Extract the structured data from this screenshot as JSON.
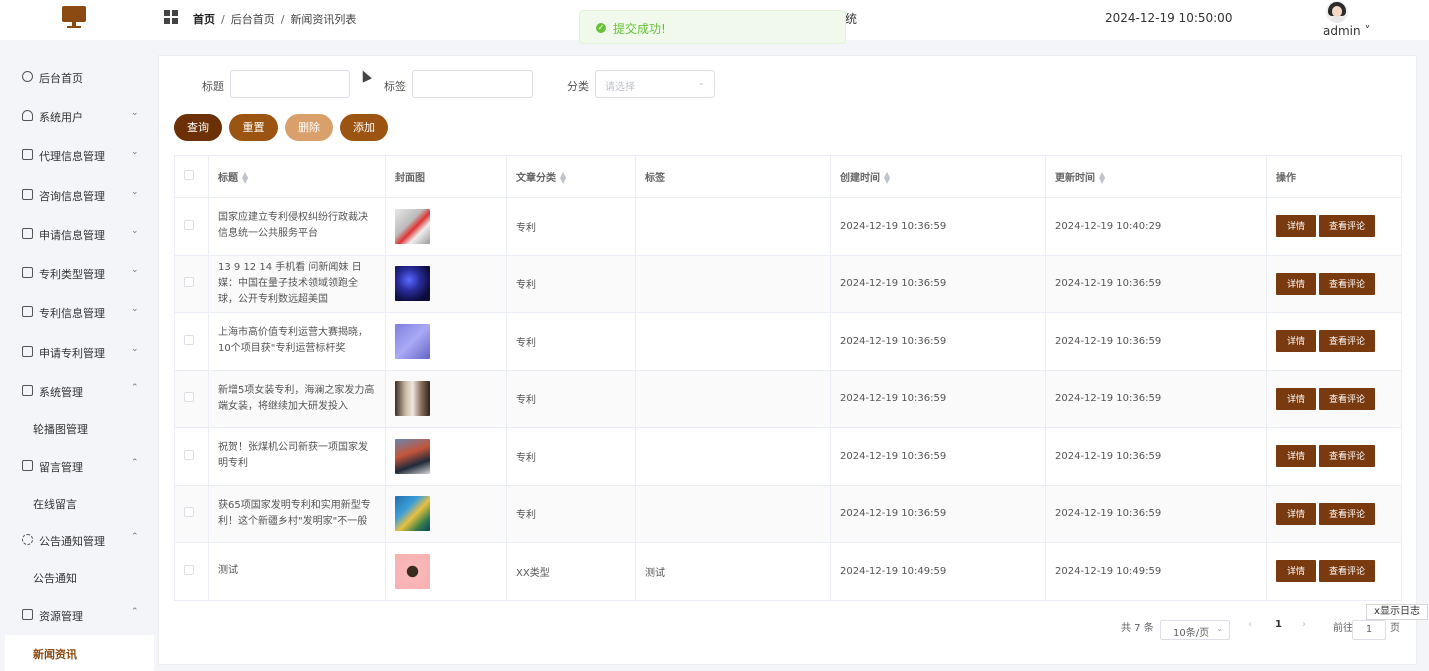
{
  "header": {
    "breadcrumb": [
      "首页",
      "后台首页",
      "新闻资讯列表"
    ],
    "sys_title": "统",
    "datetime": "2024-12-19 10:50:00",
    "user": "admin"
  },
  "toast": {
    "message": "提交成功!",
    "color": "#67c23a"
  },
  "sidebar": {
    "items": [
      {
        "label": "后台首页",
        "icon": "dashboard-icon",
        "arrow": ""
      },
      {
        "label": "系统用户",
        "icon": "user-icon",
        "arrow": "⌄"
      },
      {
        "label": "代理信息管理",
        "icon": "card-icon",
        "arrow": "⌄"
      },
      {
        "label": "咨询信息管理",
        "icon": "card-icon",
        "arrow": "⌄"
      },
      {
        "label": "申请信息管理",
        "icon": "card-icon",
        "arrow": "⌄"
      },
      {
        "label": "专利类型管理",
        "icon": "card-icon",
        "arrow": "⌄"
      },
      {
        "label": "专利信息管理",
        "icon": "card-icon",
        "arrow": "⌄"
      },
      {
        "label": "申请专利管理",
        "icon": "card-icon",
        "arrow": "⌄"
      },
      {
        "label": "系统管理",
        "icon": "check-icon",
        "arrow": "⌃"
      },
      {
        "label": "留言管理",
        "icon": "inbox-icon",
        "arrow": "⌃"
      },
      {
        "label": "公告通知管理",
        "icon": "sun-icon",
        "arrow": "⌃"
      },
      {
        "label": "资源管理",
        "icon": "folder-icon",
        "arrow": "⌃"
      }
    ],
    "subitems": [
      "轮播图管理",
      "在线留言",
      "公告通知",
      "新闻资讯"
    ]
  },
  "filters": {
    "title_label": "标题",
    "tag_label": "标签",
    "category_label": "分类",
    "category_placeholder": "请选择"
  },
  "buttons": {
    "query": "查询",
    "reset": "重置",
    "delete": "删除",
    "add": "添加"
  },
  "colors": {
    "accent": "#7a3a10",
    "query": "#6b3005",
    "reset": "#9c5412",
    "delete": "#d9a06b",
    "add": "#9c5412"
  },
  "table": {
    "columns": [
      "标题",
      "封面图",
      "文章分类",
      "标签",
      "创建时间",
      "更新时间",
      "操作"
    ],
    "rows": [
      {
        "title": "国家应建立专利侵权纠纷行政裁决信息统一公共服务平台",
        "category": "专利",
        "tag": "",
        "created": "2024-12-19 10:36:59",
        "updated": "2024-12-19 10:40:29"
      },
      {
        "title": "13 9 12 14 手机看 问新闻妹 日媒：中国在量子技术领域领跑全球，公开专利数远超美国",
        "category": "专利",
        "tag": "",
        "created": "2024-12-19 10:36:59",
        "updated": "2024-12-19 10:36:59"
      },
      {
        "title": "上海市高价值专利运营大赛揭晓，10个项目获\"专利运营标杆奖",
        "category": "专利",
        "tag": "",
        "created": "2024-12-19 10:36:59",
        "updated": "2024-12-19 10:36:59"
      },
      {
        "title": "新增5项女装专利，海澜之家发力高端女装，将继续加大研发投入",
        "category": "专利",
        "tag": "",
        "created": "2024-12-19 10:36:59",
        "updated": "2024-12-19 10:36:59"
      },
      {
        "title": "祝贺！张煤机公司新获一项国家发明专利",
        "category": "专利",
        "tag": "",
        "created": "2024-12-19 10:36:59",
        "updated": "2024-12-19 10:36:59"
      },
      {
        "title": "获65项国家发明专利和实用新型专利！这个新疆乡村\"发明家\"不一般",
        "category": "专利",
        "tag": "",
        "created": "2024-12-19 10:36:59",
        "updated": "2024-12-19 10:36:59"
      },
      {
        "title": "测试",
        "category": "XX类型",
        "tag": "测试",
        "created": "2024-12-19 10:49:59",
        "updated": "2024-12-19 10:49:59"
      }
    ],
    "op_detail": "详情",
    "op_comments": "查看评论"
  },
  "pagination": {
    "total": "共 7 条",
    "page_size": "10条/页",
    "current": "1",
    "goto_label": "前往",
    "goto_value": "1",
    "page_suffix": "页"
  },
  "log_toggle": "x显示日志"
}
